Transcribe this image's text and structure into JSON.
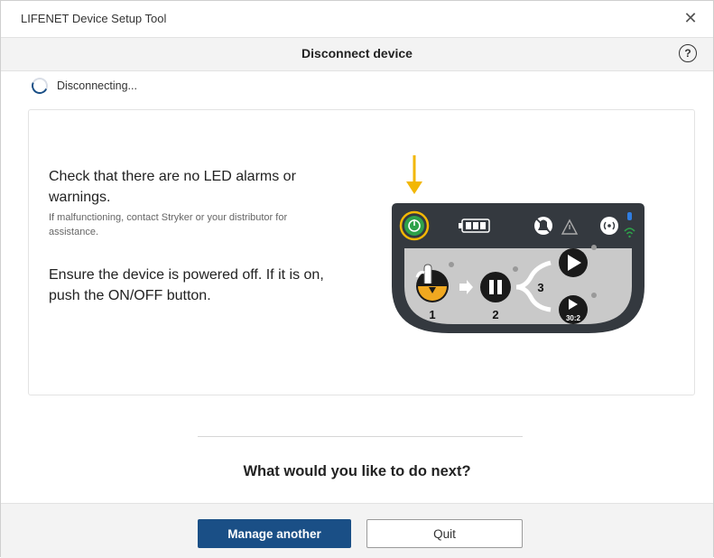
{
  "window": {
    "title": "LIFENET Device Setup Tool",
    "close_icon": "close-icon"
  },
  "header": {
    "title": "Disconnect device",
    "help_icon": "help-icon",
    "help_glyph": "?"
  },
  "status": {
    "text": "Disconnecting...",
    "icon": "spinner-icon"
  },
  "instructions": {
    "check_text": "Check that there are no LED alarms or warnings.",
    "check_subtext": "If malfunctioning, contact Stryker or your distributor for assistance.",
    "power_off_text": "Ensure the device is powered off. If it is on, push the ON/OFF button."
  },
  "device_panel": {
    "step_labels": [
      "1",
      "2",
      "3"
    ],
    "mode_label": "30:2",
    "icons": [
      "arrow-down-icon",
      "power-icon",
      "battery-icon",
      "alarm-silenced-icon",
      "warning-icon",
      "wireless-icon",
      "bluetooth-icon",
      "wifi-icon",
      "hand-press-icon",
      "pause-icon",
      "play-icon"
    ],
    "colors": {
      "panel": "#34393f",
      "panel_inner": "#c9c9c9",
      "power_green": "#2ea24a",
      "highlight": "#f2b705"
    }
  },
  "next": {
    "question": "What would you like to do next?"
  },
  "footer": {
    "manage_label": "Manage another",
    "quit_label": "Quit"
  },
  "colors": {
    "primary": "#1a4f86",
    "header_bg": "#f3f3f3"
  }
}
